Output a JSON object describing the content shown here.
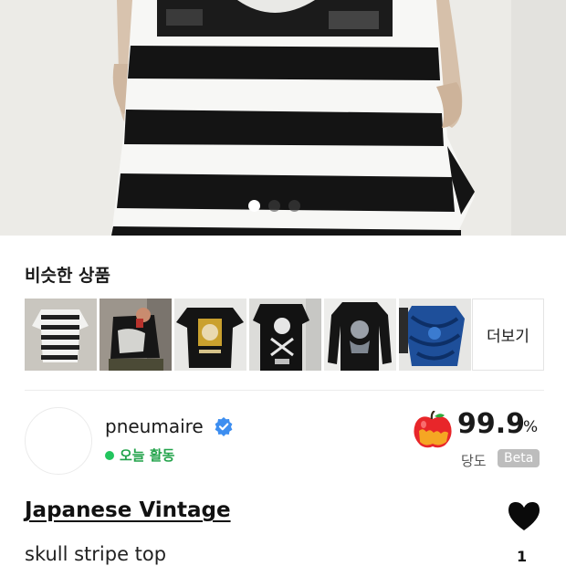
{
  "gallery": {
    "slide_count": 3,
    "active_slide": 1
  },
  "similar": {
    "title": "비슷한 상품",
    "more_label": "더보기",
    "thumbnails": [
      {
        "name": "striped-shirt-thumbnail"
      },
      {
        "name": "graphic-tee-person-thumbnail"
      },
      {
        "name": "tiger-print-tee-thumbnail"
      },
      {
        "name": "skull-print-tee-thumbnail"
      },
      {
        "name": "longsleeve-print-thumbnail"
      },
      {
        "name": "blue-tiedye-tee-thumbnail"
      }
    ]
  },
  "seller": {
    "name": "pneumaire",
    "verified_icon": "verified-badge-icon",
    "status": "오늘 활동",
    "status_color": "#22c55e",
    "score": "99.9",
    "score_unit": "%",
    "score_label": "당도",
    "score_badge": "Beta"
  },
  "product": {
    "brand": "Japanese Vintage",
    "name": "skull stripe top",
    "like_count": "1"
  }
}
